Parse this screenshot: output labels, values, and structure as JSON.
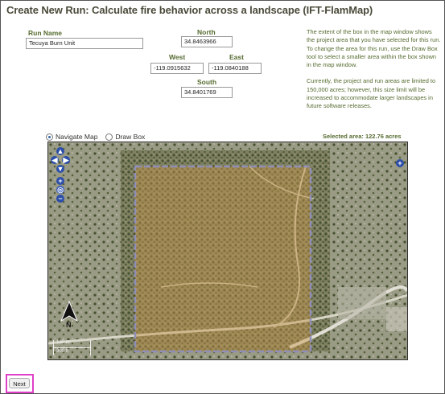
{
  "page": {
    "title": "Create New Run: Calculate fire behavior across a landscape (IFT-FlamMap)"
  },
  "form": {
    "run_name_label": "Run Name",
    "run_name_value": "Tecuya Burn Unit",
    "north_label": "North",
    "north_value": "34.8463966",
    "west_label": "West",
    "west_value": "-119.0915632",
    "east_label": "East",
    "east_value": "-119.0840188",
    "south_label": "South",
    "south_value": "34.8401769"
  },
  "info": {
    "paragraph1": "The extent of the box in the map window shows the project area that you have selected for this run. To change the area for this run, use the Draw Box tool to select a smaller area within the box shown in the map window.",
    "paragraph2": "Currently, the project and run areas are limited to 150,000 acres; however, this size limit will be increased to accommodate larger landscapes in future software releases."
  },
  "map_tools": {
    "navigate_label": "Navigate Map",
    "draw_label": "Draw Box",
    "selected_mode": "navigate",
    "selected_area": "Selected area: 122.76 acres"
  },
  "map": {
    "north_arrow_label": "N",
    "scale_top": "100 m",
    "scale_bottom": "300 ft",
    "icons": [
      "pan-north-icon",
      "pan-west-icon",
      "pan-east-icon",
      "pan-south-icon",
      "zoom-in-icon",
      "zoom-world-icon",
      "zoom-out-icon",
      "layer-switcher-icon"
    ],
    "selection_color": "#c8954a"
  },
  "footer": {
    "next_label": "Next"
  },
  "colors": {
    "title": "#4a4a3a",
    "label": "#556b2f",
    "highlight": "#e040c8"
  }
}
